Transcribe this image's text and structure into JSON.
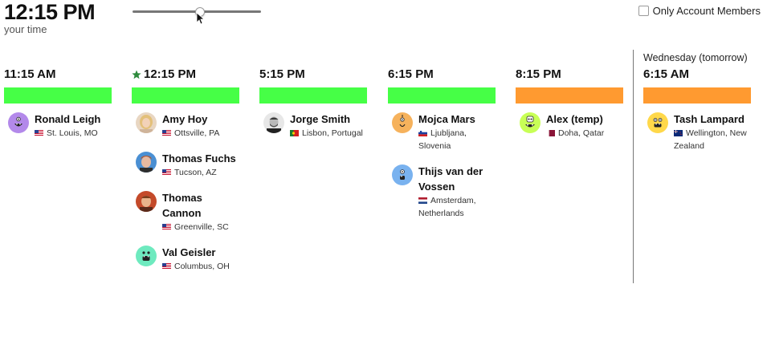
{
  "header": {
    "current_time": "12:15 PM",
    "subtitle": "your time",
    "slider_value": 0.52,
    "filter_label": "Only Account Members",
    "filter_checked": false
  },
  "colors": {
    "green": "#46ff46",
    "orange": "#ff9a30",
    "star": "#2e8b3d"
  },
  "columns": [
    {
      "day_label": "",
      "time": "11:15 AM",
      "starred": false,
      "bar_color": "#46ff46",
      "people": [
        {
          "name": "Ronald Leigh",
          "flag": "us",
          "location": "St. Louis, MO",
          "avatar": "purple-monster-icon"
        }
      ]
    },
    {
      "day_label": "",
      "time": "12:15 PM",
      "starred": true,
      "bar_color": "#46ff46",
      "people": [
        {
          "name": "Amy Hoy",
          "flag": "us",
          "location": "Ottsville, PA",
          "avatar": "photo-amy"
        },
        {
          "name": "Thomas Fuchs",
          "flag": "us",
          "location": "Tucson, AZ",
          "avatar": "photo-thomas-f"
        },
        {
          "name": "Thomas Cannon",
          "flag": "us",
          "location": "Greenville, SC",
          "avatar": "photo-thomas-c"
        },
        {
          "name": "Val Geisler",
          "flag": "us",
          "location": "Columbus, OH",
          "avatar": "green-monster-icon"
        }
      ]
    },
    {
      "day_label": "",
      "time": "5:15 PM",
      "starred": false,
      "bar_color": "#46ff46",
      "people": [
        {
          "name": "Jorge Smith",
          "flag": "pt",
          "location": "Lisbon, Portugal",
          "avatar": "photo-jorge"
        }
      ]
    },
    {
      "day_label": "",
      "time": "6:15 PM",
      "starred": false,
      "bar_color": "#46ff46",
      "people": [
        {
          "name": "Mojca Mars",
          "flag": "si",
          "location": "Ljubljana, Slovenia",
          "avatar": "orange-monster-icon"
        },
        {
          "name": "Thijs van der Vossen",
          "flag": "nl",
          "location": "Amsterdam, Netherlands",
          "avatar": "blue-monster-icon"
        }
      ]
    },
    {
      "day_label": "",
      "time": "8:15 PM",
      "starred": false,
      "bar_color": "#ff9a30",
      "people": [
        {
          "name": "Alex (temp)",
          "flag": "qa",
          "location": "Doha, Qatar",
          "avatar": "lime-monster-icon"
        }
      ]
    },
    {
      "day_label": "Wednesday (tomorrow)",
      "time": "6:15 AM",
      "starred": false,
      "bar_color": "#ff9a30",
      "people": [
        {
          "name": "Tash Lampard",
          "flag": "nz",
          "location": "Wellington, New Zealand",
          "avatar": "yellow-monster-icon"
        }
      ]
    }
  ]
}
